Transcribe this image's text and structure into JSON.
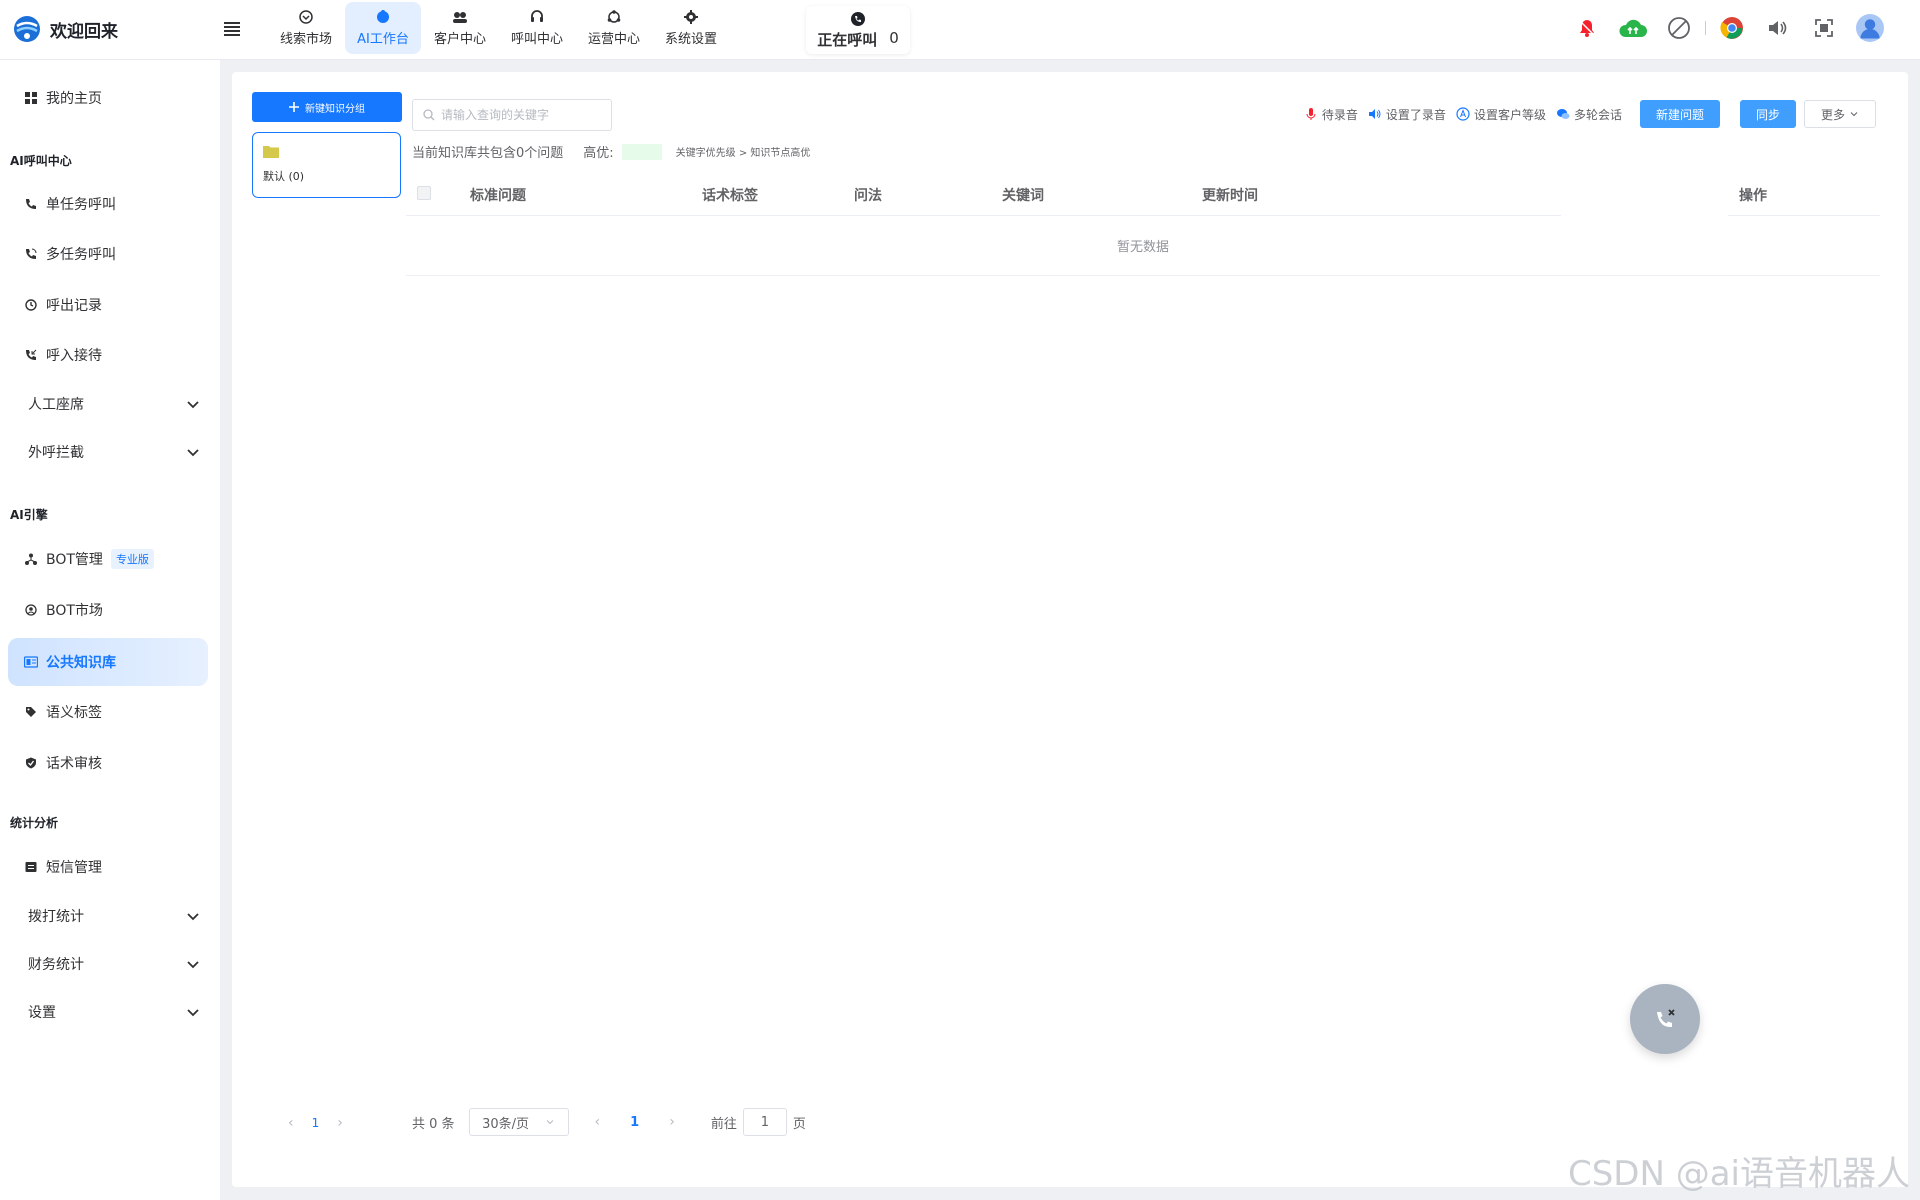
{
  "app": {
    "title": "欢迎回来"
  },
  "nav": [
    {
      "label": "线索市场",
      "icon": "clue-icon"
    },
    {
      "label": "AI工作台",
      "icon": "ai-workbench-icon",
      "active": true
    },
    {
      "label": "客户中心",
      "icon": "customers-icon"
    },
    {
      "label": "呼叫中心",
      "icon": "headset-icon"
    },
    {
      "label": "运营中心",
      "icon": "operations-icon"
    },
    {
      "label": "系统设置",
      "icon": "gear-icon"
    }
  ],
  "calling": {
    "label": "正在呼叫",
    "count": "0"
  },
  "sidebar": {
    "home": "我的主页",
    "section_call": "AI呼叫中心",
    "single_call": "单任务呼叫",
    "multi_call": "多任务呼叫",
    "call_records": "呼出记录",
    "inbound": "呼入接待",
    "agents": "人工座席",
    "intercept": "外呼拦截",
    "section_ai": "AI引擎",
    "bot_manage": "BOT管理",
    "bot_badge": "专业版",
    "bot_market": "BOT市场",
    "knowledge": "公共知识库",
    "semantic_tags": "语义标签",
    "script_review": "话术审核",
    "section_stats": "统计分析",
    "sms": "短信管理",
    "dial_stats": "拨打统计",
    "finance_stats": "财务统计",
    "settings": "设置"
  },
  "main": {
    "new_group_button": "新键知识分组",
    "group": {
      "name": "默认 (0)"
    },
    "search_placeholder": "请输入查询的关键字",
    "info_text": "当前知识库共包含0个问题",
    "highlight_label": "高优:",
    "highlight_note": "关键字优先级 > 知识节点高优",
    "tools": {
      "pending_record": "待录音",
      "recorded": "设置了录音",
      "customer_level": "设置客户等级",
      "multi_turn": "多轮会话"
    },
    "buttons": {
      "new_question": "新建问题",
      "sync": "同步",
      "more": "更多"
    },
    "table": {
      "columns": [
        "标准问题",
        "话术标签",
        "问法",
        "关键词",
        "更新时间",
        "操作"
      ],
      "empty_text": "暂无数据"
    },
    "pager": {
      "left_page": "1",
      "total": "共 0 条",
      "page_size": "30条/页",
      "current": "1",
      "goto_label": "前往",
      "goto_value": "1",
      "page_unit": "页"
    }
  },
  "watermark": "CSDN @ai语音机器人",
  "colors": {
    "primary": "#1677ff",
    "button_blue": "#409eff",
    "highlight_bg": "#e6fbea",
    "notify_red": "#f5222d",
    "cloud_green": "#2ab54a"
  }
}
